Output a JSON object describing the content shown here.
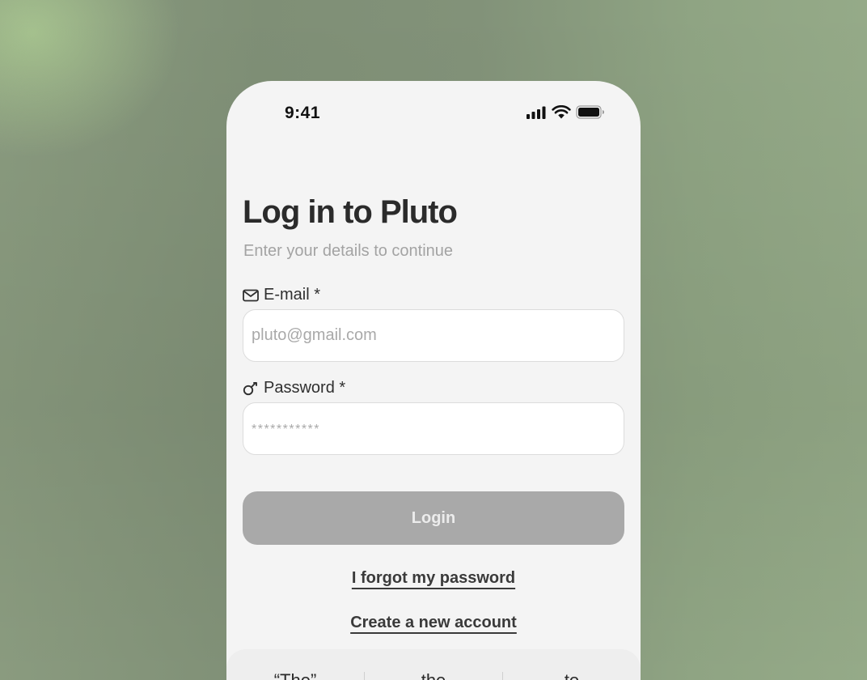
{
  "status_bar": {
    "time": "9:41",
    "icons": [
      "cellular-signal-icon",
      "wifi-icon",
      "battery-icon"
    ]
  },
  "login": {
    "title": "Log in to Pluto",
    "subtitle": "Enter your details to continue",
    "email": {
      "label": "E-mail *",
      "icon": "mail-icon",
      "value": "",
      "placeholder": "pluto@gmail.com"
    },
    "password": {
      "label": "Password *",
      "icon": "key-icon",
      "value": "",
      "placeholder": "***********"
    },
    "login_button": "Login",
    "forgot_link": "I forgot my password",
    "create_link": "Create a new account"
  },
  "keyboard": {
    "suggestions": [
      "“The”",
      "the",
      "to"
    ]
  },
  "colors": {
    "button_disabled": "#a9a9a9",
    "title": "#2b2b2b",
    "subtitle": "#a3a3a3"
  }
}
